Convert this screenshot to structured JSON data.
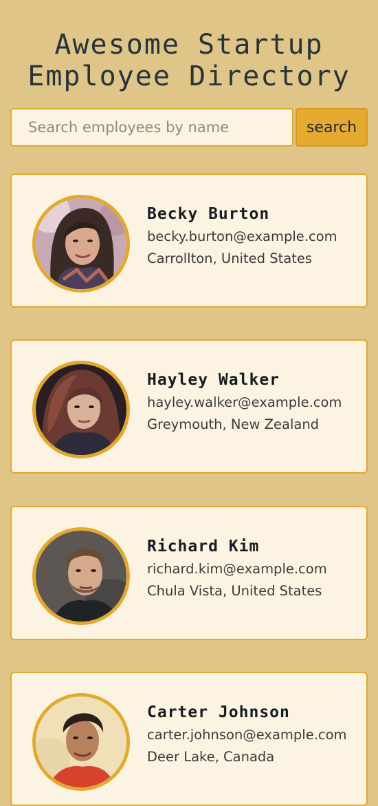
{
  "header": {
    "title_line1": "Awesome Startup",
    "title_line2": "Employee Directory"
  },
  "search": {
    "placeholder": "Search employees by name",
    "value": "",
    "button_label": "search"
  },
  "colors": {
    "background": "#e0c588",
    "card_background": "#fcf3e3",
    "accent": "#e3a92e"
  },
  "employees": [
    {
      "name": "Becky Burton",
      "email": "becky.burton@example.com",
      "location": "Carrollton, United States",
      "avatar": "woman-dark-hair-portrait"
    },
    {
      "name": "Hayley Walker",
      "email": "hayley.walker@example.com",
      "location": "Greymouth, New Zealand",
      "avatar": "woman-long-hair-portrait"
    },
    {
      "name": "Richard Kim",
      "email": "richard.kim@example.com",
      "location": "Chula Vista, United States",
      "avatar": "man-beard-portrait"
    },
    {
      "name": "Carter Johnson",
      "email": "carter.johnson@example.com",
      "location": "Deer Lake, Canada",
      "avatar": "man-red-shirt-portrait"
    }
  ]
}
